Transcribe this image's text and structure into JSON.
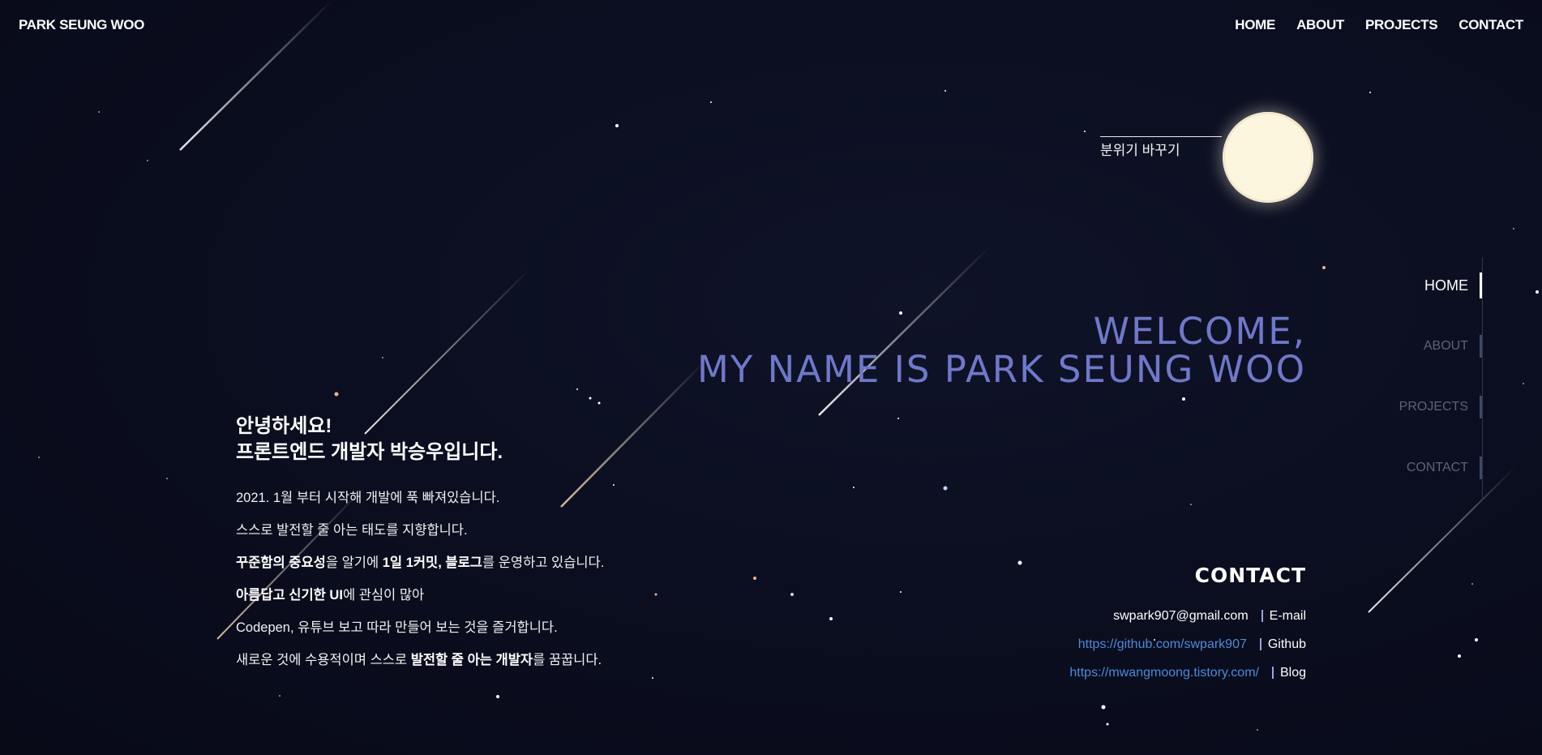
{
  "header": {
    "brand": "PARK SEUNG WOO",
    "nav": [
      "HOME",
      "ABOUT",
      "PROJECTS",
      "CONTACT"
    ]
  },
  "mood_toggle": {
    "label": "분위기 바꾸기"
  },
  "hero": {
    "line1": "WELCOME,",
    "line2": "MY NAME IS PARK SEUNG WOO"
  },
  "intro": {
    "greeting": "안녕하세요!",
    "headline": "프론트엔드 개발자 박승우입니다.",
    "paragraphs": [
      [
        {
          "t": "2021. 1월 부터 시작해 개발에 푹 빠져있습니다.",
          "b": false
        }
      ],
      [
        {
          "t": "스스로 발전할 줄 아는 태도를 지향합니다.",
          "b": false
        }
      ],
      [
        {
          "t": "꾸준함의 중요성",
          "b": true
        },
        {
          "t": "을 알기에 ",
          "b": false
        },
        {
          "t": "1일 1커밋,",
          "b": true
        },
        {
          "t": " ",
          "b": false
        },
        {
          "t": "블로그",
          "b": true
        },
        {
          "t": "를 운영하고 있습니다.",
          "b": false
        }
      ],
      [
        {
          "t": "아름답고 신기한 UI",
          "b": true
        },
        {
          "t": "에 관심이 많아",
          "b": false
        }
      ],
      [
        {
          "t": "Codepen, 유튜브 보고 따라 만들어 보는 것을 즐거합니다.",
          "b": false
        }
      ],
      [
        {
          "t": "새로운 것에 수용적이며 스스로 ",
          "b": false
        },
        {
          "t": "발전할 줄 아는 개발자",
          "b": true
        },
        {
          "t": "를 꿈꿉니다.",
          "b": false
        }
      ]
    ]
  },
  "side_nav": {
    "items": [
      "HOME",
      "ABOUT",
      "PROJECTS",
      "CONTACT"
    ],
    "active": "HOME"
  },
  "contact": {
    "title": "CONTACT",
    "rows": [
      {
        "value": "swpark907@gmail.com",
        "label": "E-mail",
        "is_link": false
      },
      {
        "value": "https://github.com/swpark907",
        "label": "Github",
        "is_link": true
      },
      {
        "value": "https://mwangmoong.tistory.com/",
        "label": "Blog",
        "is_link": true
      }
    ]
  },
  "colors": {
    "background": "#0a0d1e",
    "hero_text": "#6f78c9",
    "moon": "#fdf6df",
    "link": "#4e8ad8"
  }
}
